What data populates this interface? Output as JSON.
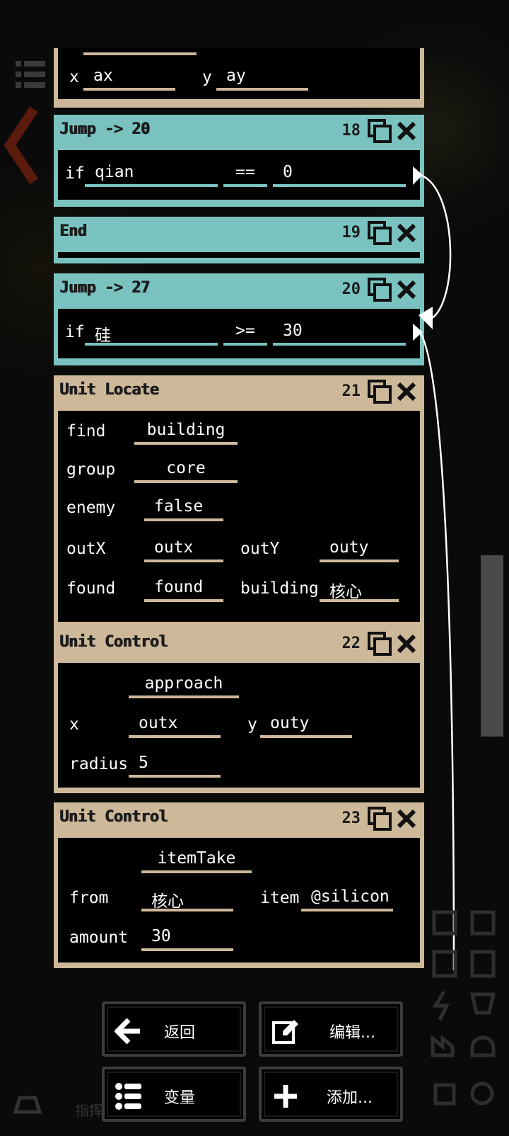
{
  "top_block": {
    "x_label": "x",
    "x_value": "ax",
    "y_label": "y",
    "y_value": "ay"
  },
  "blocks": [
    {
      "title": "Jump -> 20",
      "number": "18",
      "if_label": "if",
      "a": "qian",
      "op": "==",
      "b": "0"
    },
    {
      "title": "End",
      "number": "19"
    },
    {
      "title": "Jump -> 27",
      "number": "20",
      "if_label": "if",
      "a": "硅",
      "op": ">=",
      "b": "30"
    },
    {
      "title": "Unit Locate",
      "number": "21",
      "find_label": "find",
      "find_value": "building",
      "group_label": "group",
      "group_value": "core",
      "enemy_label": "enemy",
      "enemy_value": "false",
      "outx_label": "outX",
      "outx_value": "outx",
      "outy_label": "outY",
      "outy_value": "outy",
      "found_label": "found",
      "found_value": "found",
      "building_label": "building",
      "building_value": "核心"
    },
    {
      "title": "Unit Control",
      "number": "22",
      "action": "approach",
      "x_label": "x",
      "x_value": "outx",
      "y_label": "y",
      "y_value": "outy",
      "radius_label": "radius",
      "radius_value": "5"
    },
    {
      "title": "Unit Control",
      "number": "23",
      "action": "itemTake",
      "from_label": "from",
      "from_value": "核心",
      "item_label": "item",
      "item_value": "@silicon",
      "amount_label": "amount",
      "amount_value": "30"
    }
  ],
  "buttons": {
    "back": "返回",
    "edit": "编辑...",
    "vars": "变量",
    "add": "添加..."
  },
  "bottom_hint": "指挥",
  "colors": {
    "jump": "#7ac2bf",
    "unit": "#cdb89a",
    "background": "#000000"
  }
}
